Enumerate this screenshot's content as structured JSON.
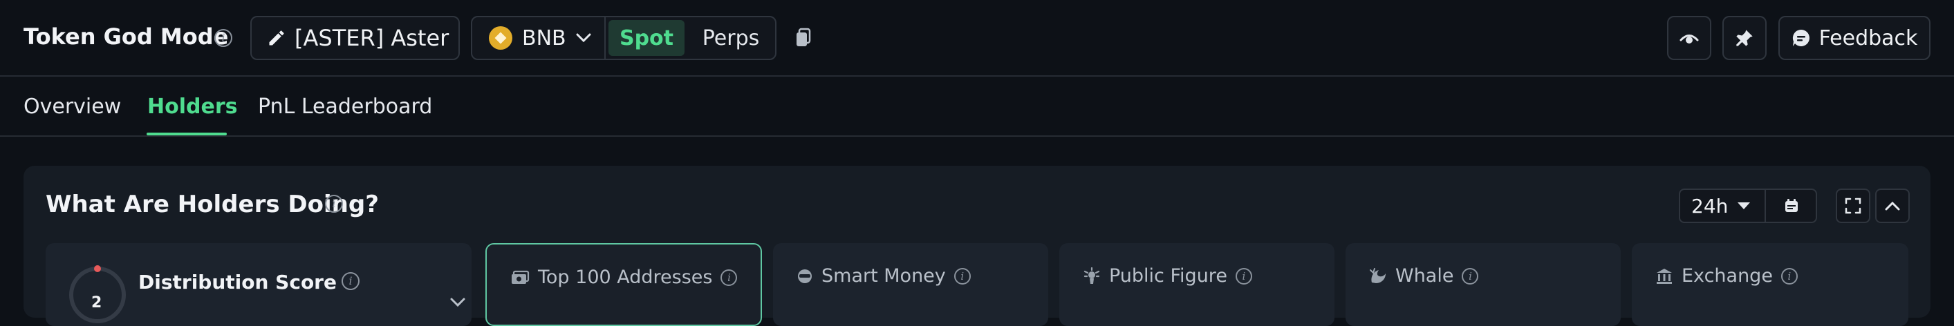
{
  "header": {
    "title": "Token God Mode",
    "token_label": "[ASTER] Aster",
    "chain": "BNB",
    "market_tabs": [
      {
        "label": "Spot",
        "active": true
      },
      {
        "label": "Perps",
        "active": false
      }
    ],
    "feedback_label": "Feedback",
    "icons": [
      "info-icon",
      "pencil-icon",
      "bnb-icon",
      "chevron-down-icon",
      "copy-icon",
      "eye-icon",
      "pin-icon",
      "chat-bubble-icon"
    ]
  },
  "tabs": [
    {
      "label": "Overview",
      "active": false
    },
    {
      "label": "Holders",
      "active": true
    },
    {
      "label": "PnL Leaderboard",
      "active": false
    }
  ],
  "panel": {
    "title": "What Are Holders Doing?",
    "time_range": "24h",
    "distribution": {
      "label": "Distribution Score",
      "score": "2"
    },
    "segments": [
      {
        "label": "Top 100 Addresses",
        "icon": "money-icon",
        "selected": true
      },
      {
        "label": "Smart Money",
        "icon": "smart-money-icon",
        "selected": false
      },
      {
        "label": "Public Figure",
        "icon": "public-figure-icon",
        "selected": false
      },
      {
        "label": "Whale",
        "icon": "whale-icon",
        "selected": false
      },
      {
        "label": "Exchange",
        "icon": "bank-icon",
        "selected": false
      }
    ]
  },
  "colors": {
    "background": "#0d1117",
    "panel": "#161c24",
    "accent_green": "#4fdc8f",
    "selected_border": "#5fc7a2",
    "bnb_gold": "#e3ad2a"
  }
}
